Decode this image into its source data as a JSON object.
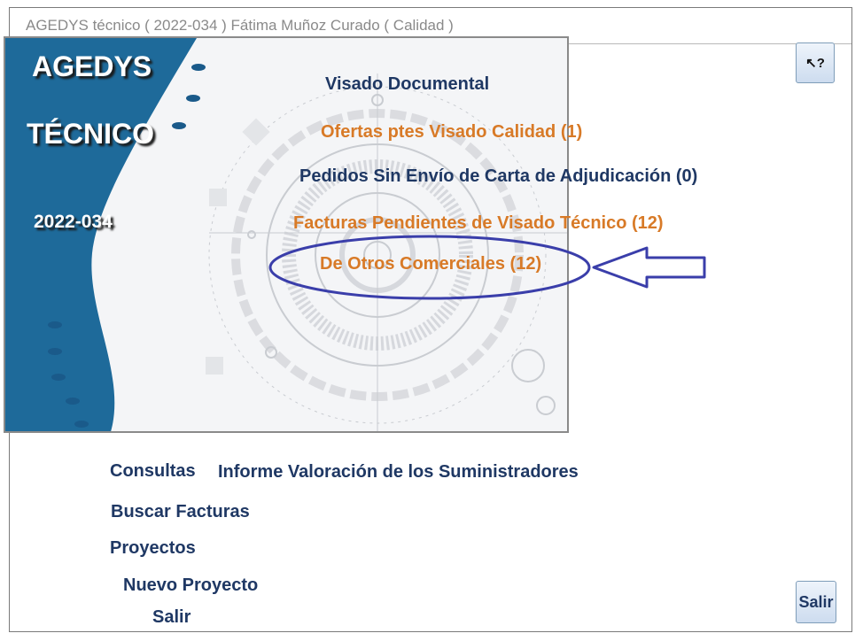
{
  "window": {
    "title": "AGEDYS técnico ( 2022-034 ) Fátima Muñoz Curado ( Calidad )"
  },
  "help_button": {
    "label": "↖?",
    "icon": "help-pointer-icon"
  },
  "banner": {
    "title_line1": "AGEDYS",
    "title_line2": "TÉCNICO",
    "code": "2022-034",
    "colors": {
      "wave": "#1e6a9a",
      "text": "#ffffff"
    }
  },
  "links": {
    "visado": "Visado Documental",
    "ofertas": "Ofertas ptes Visado Calidad (1)",
    "pedidos": "Pedidos Sin Envío de Carta de Adjudicación (0)",
    "facturas": "Facturas Pendientes de Visado Técnico (12)",
    "otros": "De Otros Comerciales (12)"
  },
  "bottom": {
    "consultas": "Consultas",
    "informe": "Informe Valoración de los Suministradores",
    "buscar": "Buscar Facturas",
    "proyectos": "Proyectos",
    "nuevo": "Nuevo Proyecto",
    "salir": "Salir"
  },
  "salir_button": {
    "label": "Salir"
  },
  "colors": {
    "navy": "#1f3864",
    "orange": "#d87a27",
    "annotation": "#3a3eaa"
  }
}
